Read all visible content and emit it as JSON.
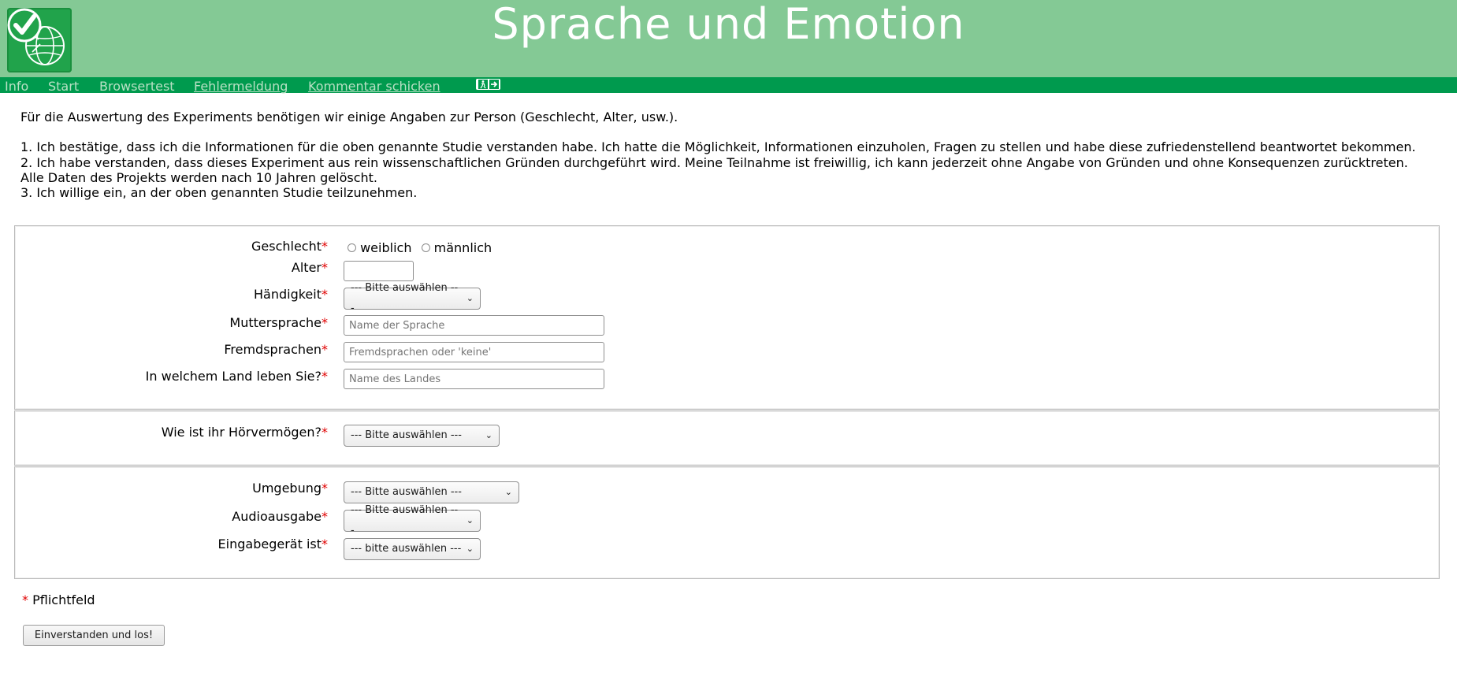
{
  "header": {
    "title": "Sprache und Emotion",
    "logo_icon": "checkmark-globe-logo",
    "brand_color": "#84c995",
    "nav_color": "#009a4e"
  },
  "nav": {
    "items": [
      "Info",
      "Start",
      "Browsertest",
      "Fehlermeldung",
      "Kommentar schicken"
    ],
    "logout_icon": "logout-icon"
  },
  "intro": {
    "line1": "Für die Auswertung des Experiments benötigen wir einige Angaben zur Person (Geschlecht, Alter, usw.).",
    "line2": "1. Ich bestätige, dass ich die Informationen für die oben genannte Studie verstanden habe. Ich hatte die Möglichkeit, Informationen einzuholen, Fragen zu stellen und habe diese zufriedenstellend beantwortet bekommen.",
    "line3": "2. Ich habe verstanden, dass dieses Experiment aus rein wissenschaftlichen Gründen durchgeführt wird. Meine Teilnahme ist freiwillig, ich kann jederzeit ohne Angabe von Gründen und ohne Konsequenzen zurücktreten.",
    "line4": "Alle Daten des Projekts werden nach 10 Jahren gelöscht.",
    "line5": "3. Ich willige ein, an der oben genannten Studie teilzunehmen."
  },
  "required_marker": "*",
  "form": {
    "geschlecht": {
      "label": "Geschlecht",
      "option1": "weiblich",
      "option2": "männlich"
    },
    "alter": {
      "label": "Alter",
      "value": ""
    },
    "haendigkeit": {
      "label": "Händigkeit",
      "selected": "--- Bitte auswählen ---"
    },
    "muttersprache": {
      "label": "Muttersprache",
      "placeholder": "Name der Sprache"
    },
    "fremdsprachen": {
      "label": "Fremdsprachen",
      "placeholder": "Fremdsprachen oder 'keine'"
    },
    "land": {
      "label": "In welchem Land leben Sie?",
      "placeholder": "Name des Landes"
    },
    "hoervermoegen": {
      "label": "Wie ist ihr Hörvermögen?",
      "selected": "--- Bitte auswählen ---"
    },
    "umgebung": {
      "label": "Umgebung",
      "selected": "--- Bitte auswählen ---"
    },
    "audioausgabe": {
      "label": "Audioausgabe",
      "selected": "--- Bitte auswählen ---"
    },
    "eingabegeraet": {
      "label": "Eingabegerät ist",
      "selected": "--- bitte auswählen ---"
    }
  },
  "footnote": "Pflichtfeld",
  "submit_label": "Einverstanden und los!"
}
